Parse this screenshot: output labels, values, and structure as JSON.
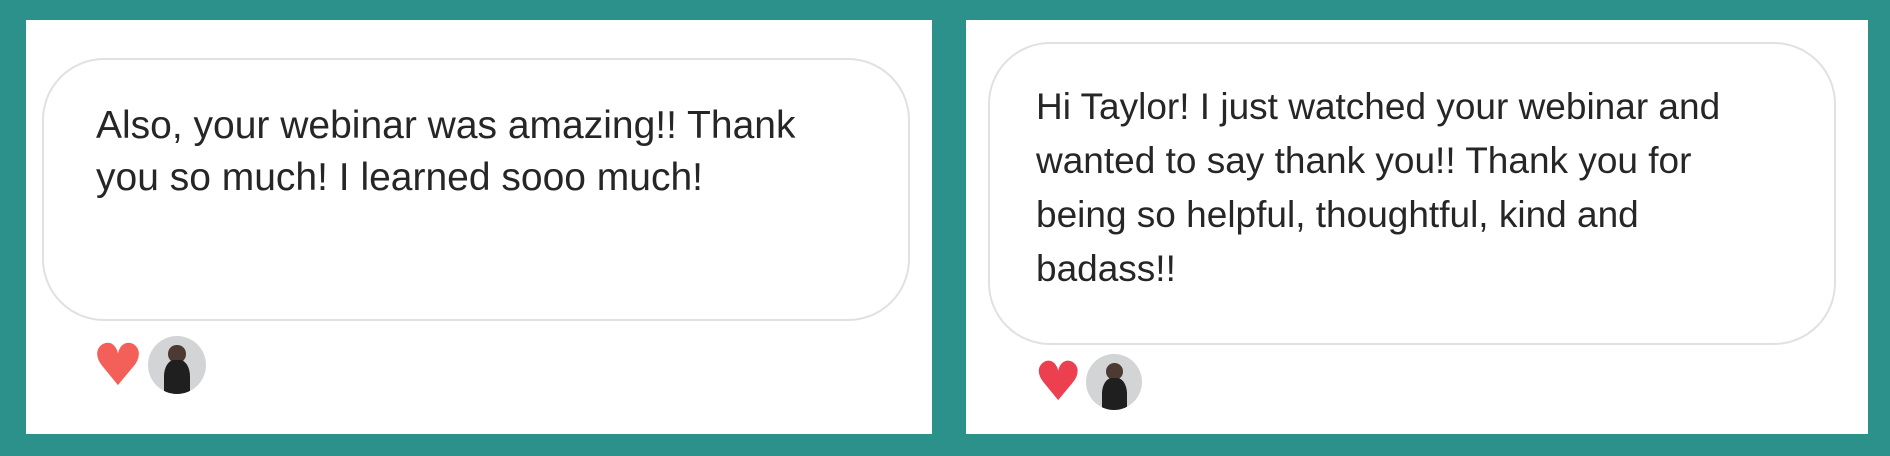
{
  "messages": [
    {
      "text": "Also, your webinar was amazing!! Thank you so much! I learned sooo much!",
      "reactions": {
        "heart_icon": "heart-icon",
        "heart_color": "#f3605a",
        "avatar_icon": "avatar-icon"
      }
    },
    {
      "text": "Hi Taylor! I just watched your webinar and wanted to say thank you!! Thank you for being so helpful, thoughtful, kind and badass!!",
      "reactions": {
        "heart_icon": "heart-icon",
        "heart_color": "#ec4050",
        "avatar_icon": "avatar-icon"
      }
    }
  ],
  "colors": {
    "background": "#2b918a",
    "panel": "#ffffff",
    "bubble_border": "#e1e1e1",
    "text": "#262626"
  }
}
